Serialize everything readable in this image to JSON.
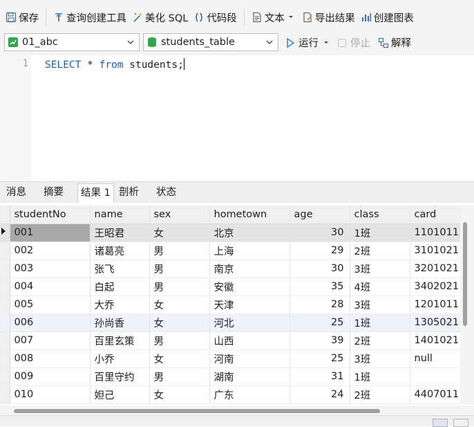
{
  "toolbar": {
    "save": "保存",
    "query_builder": "查询创建工具",
    "beautify": "美化 SQL",
    "snippet": "代码段",
    "text": "文本",
    "export": "导出结果",
    "chart": "创建图表"
  },
  "bar2": {
    "connection": "01_abc",
    "table": "students_table",
    "run": "运行",
    "stop": "停止",
    "explain": "解释"
  },
  "editor": {
    "line_number": "1",
    "kw_select": "SELECT",
    "star": " * ",
    "kw_from": "from",
    "rest": " students;"
  },
  "tabs": [
    "消息",
    "摘要",
    "结果 1",
    "剖析",
    "状态"
  ],
  "grid": {
    "columns": [
      "studentNo",
      "name",
      "sex",
      "hometown",
      "age",
      "class",
      "card"
    ],
    "rows": [
      [
        "001",
        "王昭君",
        "女",
        "北京",
        "30",
        "1班",
        "1101011"
      ],
      [
        "002",
        "诸葛亮",
        "男",
        "上海",
        "29",
        "2班",
        "3101021"
      ],
      [
        "003",
        "张飞",
        "男",
        "南京",
        "30",
        "3班",
        "3201021"
      ],
      [
        "004",
        "白起",
        "男",
        "安徽",
        "35",
        "4班",
        "3402021"
      ],
      [
        "005",
        "大乔",
        "女",
        "天津",
        "28",
        "3班",
        "1201011"
      ],
      [
        "006",
        "孙尚香",
        "女",
        "河北",
        "25",
        "1班",
        "1305021"
      ],
      [
        "007",
        "百里玄策",
        "男",
        "山西",
        "39",
        "2班",
        "1401021"
      ],
      [
        "008",
        "小乔",
        "女",
        "河南",
        "25",
        "3班",
        "null"
      ],
      [
        "009",
        "百里守约",
        "男",
        "湖南",
        "31",
        "1班",
        ""
      ],
      [
        "010",
        "妲己",
        "女",
        "广东",
        "24",
        "2班",
        "4407011"
      ]
    ],
    "selected_row": 0
  },
  "colors": {
    "keyword": "#1060c8",
    "selected_row": "#e4e4e4",
    "selected_cell": "#a9a9a9"
  }
}
